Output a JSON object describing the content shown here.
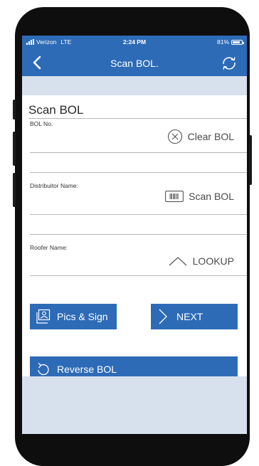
{
  "status_bar": {
    "carrier": "Verizon",
    "network": "LTE",
    "time": "2:24 PM",
    "battery": "81%"
  },
  "nav": {
    "title": "Scan BOL.",
    "back_icon": "chevron-left-icon",
    "sync_icon": "sync-icon"
  },
  "form": {
    "section_title": "Scan BOL",
    "bol_no": {
      "label": "BOL No.",
      "value": "",
      "action_label": "Clear BOL",
      "action_icon": "circle-x-icon"
    },
    "distributor": {
      "label": "Distribuitor Name:",
      "value": "",
      "action_label": "Scan BOL",
      "action_icon": "barcode-icon"
    },
    "roofer": {
      "label": "Roofer Name:",
      "value": "",
      "action_label": "LOOKUP",
      "action_icon": "chevron-up-icon"
    }
  },
  "buttons": {
    "pics_sign": "Pics & Sign",
    "next": "NEXT",
    "reverse_bol": "Reverse BOL"
  },
  "colors": {
    "primary": "#2d6bb7",
    "background": "#d7e1ee",
    "phone_frame": "#0e0e0e"
  }
}
